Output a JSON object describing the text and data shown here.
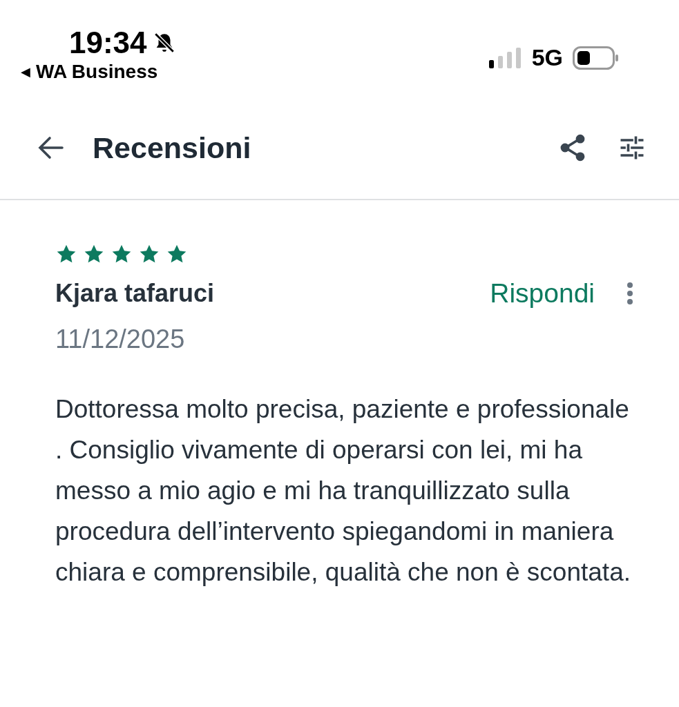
{
  "status_bar": {
    "time": "19:34",
    "silent": true,
    "back_glyph": "◀",
    "back_app": "WA Business",
    "network": "5G"
  },
  "header": {
    "title": "Recensioni"
  },
  "review": {
    "stars": 5,
    "author": "Kjara tafaruci",
    "reply_label": "Rispondi",
    "date": "11/12/2025",
    "text": "Dottoressa molto precisa, paziente e professionale . Consiglio vivamente di operarsi con lei, mi ha messo a mio agio e mi ha tranquillizzato sulla procedura dell’intervento spiegandomi in maniera chiara e comprensibile, qualità che non è scontata."
  }
}
